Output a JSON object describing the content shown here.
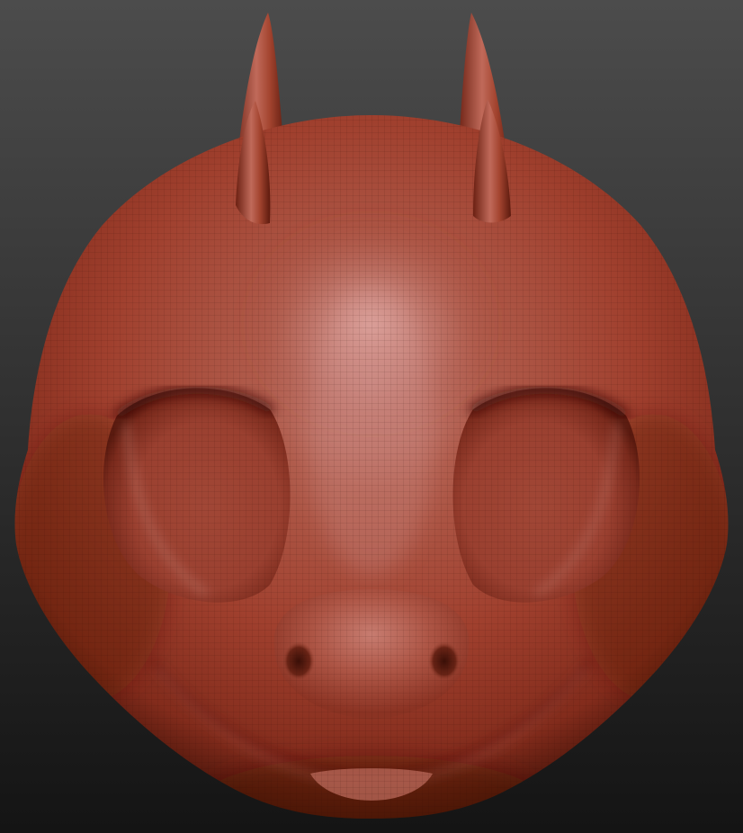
{
  "scene": {
    "subject": "sculpted-dragon-head",
    "background_top": "#4c4c4c",
    "background_bottom": "#141414",
    "clay_highlight": "#d49590",
    "clay_base": "#a0402e",
    "clay_mid": "#8f3526",
    "clay_shadow": "#3e1108",
    "wireframe_color": "#2a0b05"
  }
}
